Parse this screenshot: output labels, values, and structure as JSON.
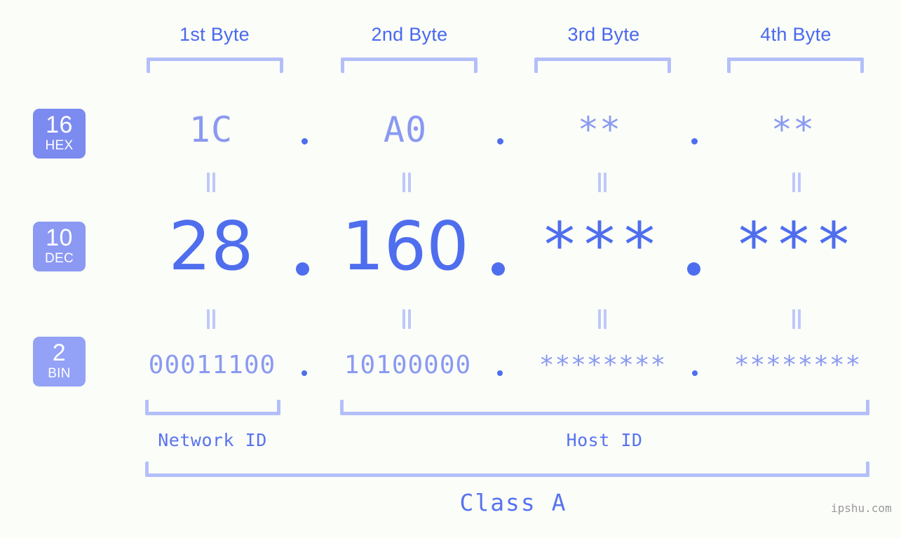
{
  "page": {
    "background_color": "#fbfdf9",
    "accent_color": "#4f6eee",
    "muted_accent_color": "#8a9af1",
    "bracket_color": "#b4bffa",
    "watermark": "ipshu.com"
  },
  "byte_headers": [
    {
      "label": "1st Byte"
    },
    {
      "label": "2nd Byte"
    },
    {
      "label": "3rd Byte"
    },
    {
      "label": "4th Byte"
    }
  ],
  "bases": [
    {
      "num": "16",
      "label": "HEX",
      "color": "#7b8bef"
    },
    {
      "num": "10",
      "label": "DEC",
      "color": "#8b99f3"
    },
    {
      "num": "2",
      "label": "BIN",
      "color": "#93a2f6"
    }
  ],
  "rows": {
    "hex": {
      "base_num": "16",
      "base_label": "HEX",
      "values": [
        "1C",
        "A0",
        "**",
        "**"
      ],
      "separator": "."
    },
    "dec": {
      "base_num": "10",
      "base_label": "DEC",
      "values": [
        "28",
        "160",
        "***",
        "***"
      ],
      "separator": "."
    },
    "bin": {
      "base_num": "2",
      "base_label": "BIN",
      "values": [
        "00011100",
        "10100000",
        "********",
        "********"
      ],
      "separator": "."
    }
  },
  "equals_symbol": "||",
  "footer": {
    "network_id_label": "Network ID",
    "host_id_label": "Host ID",
    "class_label": "Class A"
  }
}
